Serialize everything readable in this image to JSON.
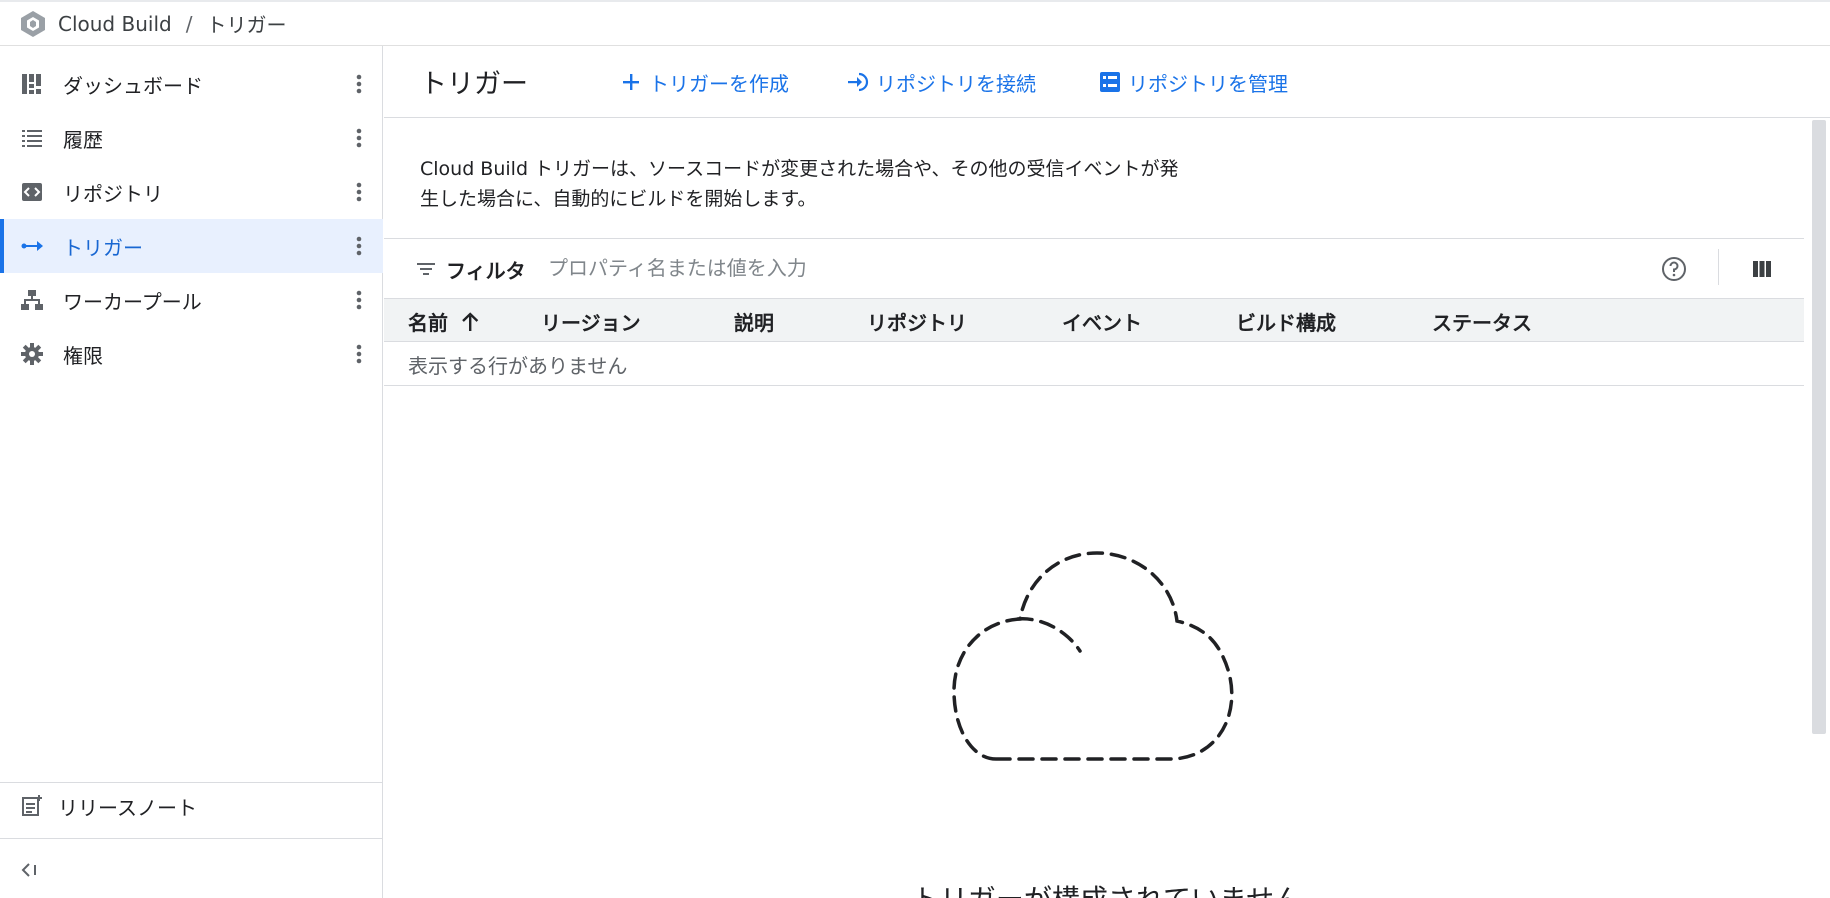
{
  "topbar": {
    "product": "Cloud Build",
    "separator": "/",
    "page": "トリガー"
  },
  "sidebar": {
    "items": [
      {
        "label": "ダッシュボード",
        "icon": "dashboard-icon",
        "active": false
      },
      {
        "label": "履歴",
        "icon": "list-icon",
        "active": false
      },
      {
        "label": "リポジトリ",
        "icon": "code-icon",
        "active": false
      },
      {
        "label": "トリガー",
        "icon": "trigger-arrow-icon",
        "active": true
      },
      {
        "label": "ワーカープール",
        "icon": "worker-pool-icon",
        "active": false
      },
      {
        "label": "権限",
        "icon": "gear-icon",
        "active": false
      }
    ],
    "release_notes": "リリースノート"
  },
  "header": {
    "title": "トリガー",
    "create_label": "トリガーを作成",
    "connect_label": "リポジトリを接続",
    "manage_label": "リポジトリを管理"
  },
  "description": "Cloud Build トリガーは、ソースコードが変更された場合や、その他の受信イベントが発生した場合に、自動的にビルドを開始します。",
  "filter": {
    "label": "フィルタ",
    "placeholder": "プロパティ名または値を入力"
  },
  "table": {
    "columns": [
      "名前",
      "リージョン",
      "説明",
      "リポジトリ",
      "イベント",
      "ビルド構成",
      "ステータス"
    ],
    "sorted_column": "名前",
    "sort_direction": "ascending",
    "empty_text": "表示する行がありません"
  },
  "empty_state": {
    "message": "トリガーが構成されていません"
  },
  "colors": {
    "accent": "#1a73e8",
    "active_bg": "#e8f0fe",
    "header_bg": "#f1f3f4",
    "divider": "#dadce0"
  }
}
